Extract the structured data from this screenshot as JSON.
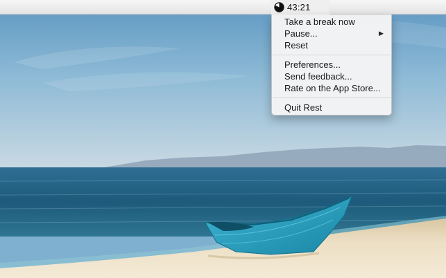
{
  "status_bar": {
    "icon": "rest-timer-icon",
    "timer": "43:21"
  },
  "menu": {
    "groups": [
      {
        "items": [
          {
            "label": "Take a break now"
          },
          {
            "label": "Pause...",
            "submenu_arrow": "▶"
          },
          {
            "label": "Reset"
          }
        ]
      },
      {
        "items": [
          {
            "label": "Preferences..."
          },
          {
            "label": "Send feedback..."
          },
          {
            "label": "Rate on the App Store..."
          }
        ]
      },
      {
        "items": [
          {
            "label": "Quit Rest"
          }
        ]
      }
    ]
  },
  "wallpaper": {
    "subject": "beach-with-blue-boat",
    "sky_color": "#7fb0d0",
    "sea_color": "#1f5c7c",
    "sand_color": "#efe2c6",
    "boat_color": "#2aa6c4"
  }
}
